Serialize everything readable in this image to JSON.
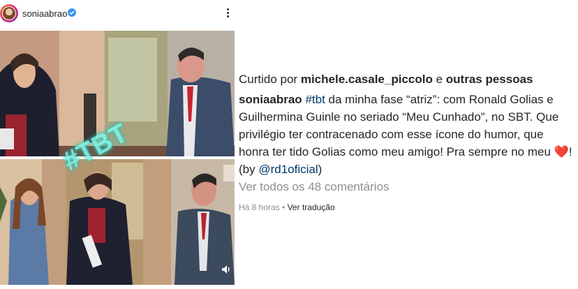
{
  "post": {
    "username": "soniaabrao",
    "overlay_text": "#TBT"
  },
  "caption": {
    "liked_prefix": "Curtido por",
    "liked_user": "michele.casale_piccolo",
    "liked_and": "e",
    "liked_others": "outras pessoas",
    "author": "soniaabrao",
    "hashtag": "#tbt",
    "text_1": " da minha fase “atriz”: com Ronald Golias e Guilhermina Guinle no seriado “Meu Cunhado”, no SBT. Que privilégio  ter contracenado com esse ícone do humor, que honra ter tido Golias como meu amigo! Pra sempre no meu ",
    "heart": "❤️",
    "text_2": "! (by ",
    "mention": "@rd1oficial",
    "text_3": ")"
  },
  "comments_link": "Ver todos os 48 comentários",
  "time": {
    "ago": "Há 8 horas",
    "separator": "•",
    "translate": "Ver tradução"
  },
  "colors": {
    "link": "#00376b",
    "muted": "#8e8e8e",
    "text": "#262626",
    "verified": "#3897f0",
    "tbt_glow": "#7ef2e6"
  },
  "icons": [
    "verified-icon",
    "more-options-icon",
    "volume-icon"
  ]
}
